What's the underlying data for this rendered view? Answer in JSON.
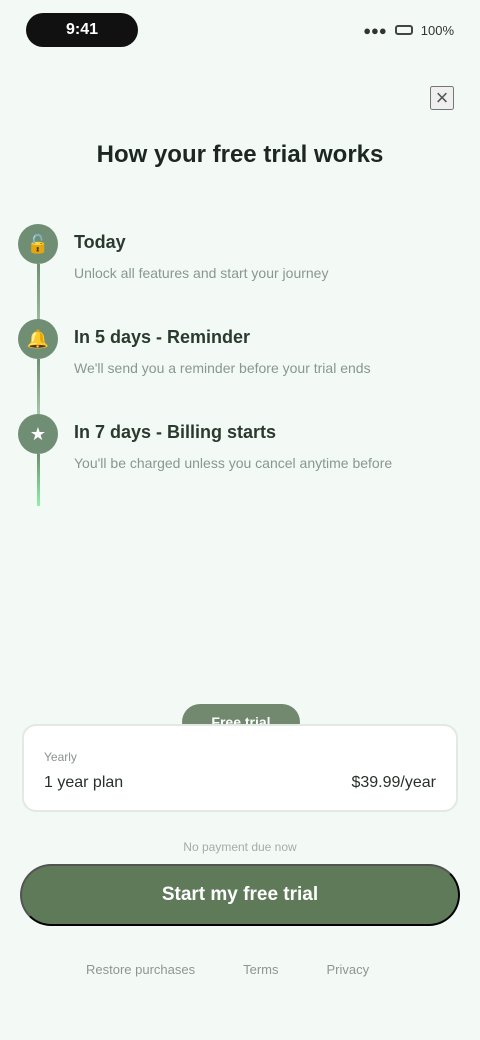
{
  "status": {
    "time": "9:41",
    "signal": "●●●",
    "battery": "100%"
  },
  "screen": {
    "title": "How your free trial works",
    "close": "×"
  },
  "timeline": [
    {
      "label": "Today",
      "desc": "Unlock all features and start your journey"
    },
    {
      "label": "In 5 days - Reminder",
      "desc": "We'll send you a reminder before your trial ends"
    },
    {
      "label": "In 7 days - Billing starts",
      "desc": "You'll be charged unless you cancel anytime before"
    }
  ],
  "plan": {
    "badge": "Free trial",
    "label": "Yearly",
    "name": "1 year plan",
    "price": "$39.99/year"
  },
  "footer": {
    "note": "No payment due now",
    "cta": "Start my free trial",
    "links": [
      "Restore purchases",
      "Terms",
      "Privacy"
    ]
  }
}
